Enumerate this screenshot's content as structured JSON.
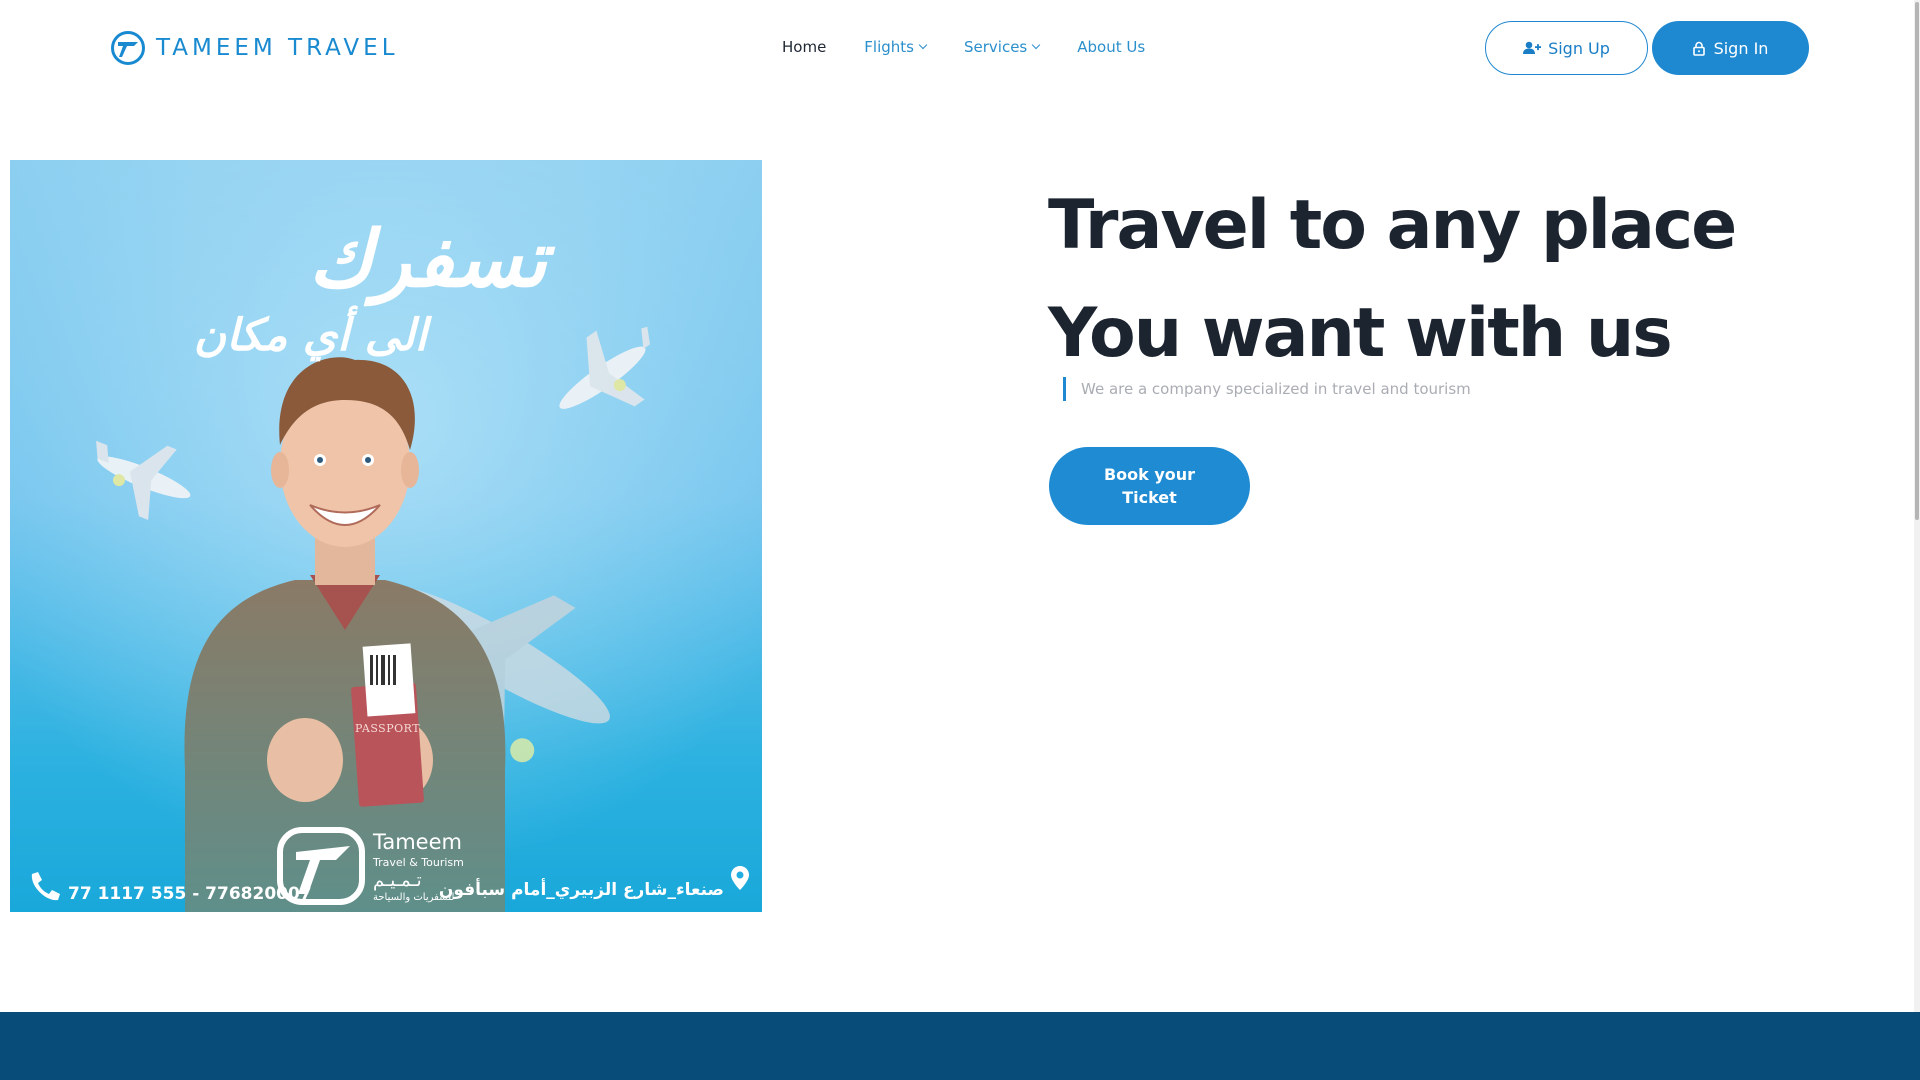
{
  "brand": {
    "name": "TAMEEM TRAVEL"
  },
  "nav": {
    "items": [
      {
        "label": "Home",
        "active": true,
        "dropdown": false
      },
      {
        "label": "Flights",
        "active": false,
        "dropdown": true
      },
      {
        "label": "Services",
        "active": false,
        "dropdown": true
      },
      {
        "label": "About Us",
        "active": false,
        "dropdown": false
      }
    ]
  },
  "auth": {
    "signup_label": "Sign Up",
    "signin_label": "Sign In"
  },
  "hero": {
    "title_line1": "Travel to any place",
    "title_line2": "You want with us",
    "subtitle": "We are a company specialized in travel and tourism",
    "cta_label": "Book your Ticket"
  },
  "poster": {
    "headline_ar": "تسفرك",
    "subheadline_ar": "الى أي مكان",
    "phone": "77 1117 555 - 776820007",
    "address_ar": "صنعاء_شارع الزبيري_أمام سبأفون",
    "brand_en": "Tameem",
    "brand_tagline": "Travel & Tourism",
    "brand_ar": "تـمـيـم",
    "brand_ar_tagline": "للسفريات والسياحة",
    "passport_text": "PASSPORT"
  },
  "colors": {
    "accent": "#1e88d1",
    "heading": "#1c2430",
    "footer": "#084c7a"
  }
}
